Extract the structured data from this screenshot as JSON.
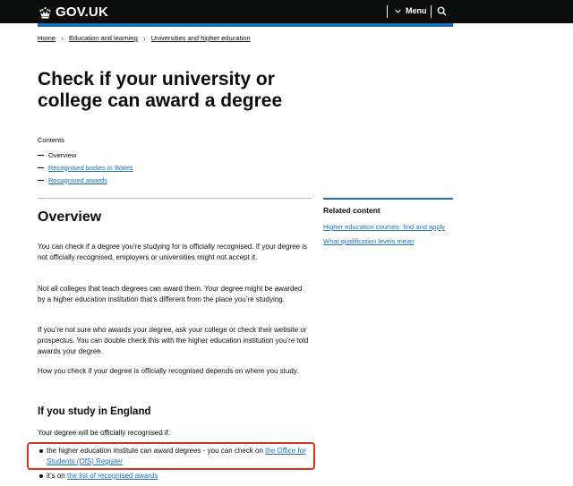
{
  "header": {
    "logo_text": "GOV.UK",
    "menu_label": "Menu"
  },
  "breadcrumb": [
    "Home",
    "Education and learning",
    "Universities and higher education"
  ],
  "page_title": "Check if your university or college can award a degree",
  "contents": {
    "label": "Contents",
    "items": [
      "Overview",
      "Recognised bodies in Wales",
      "Recognised awards"
    ]
  },
  "related": {
    "title": "Related content",
    "items": [
      "Higher education courses: find and apply",
      "What qualification levels mean"
    ]
  },
  "overview": {
    "heading": "Overview",
    "paragraphs": [
      "You can check if a degree you’re studying for is officially recognised. If your degree is not officially recognised, employers or universities might not accept it.",
      "Not all colleges that teach degrees can award them. Your degree might be awarded by a higher education institution that’s different from the place you’re studying.",
      "If you’re not sure who awards your degree, ask your college or check their website or prospectus. You can double check this with the higher education institution you’re told awards your degree.",
      "How you check if your degree is officially recognised depends on where you study."
    ]
  },
  "england": {
    "heading": "If you study in England",
    "intro": "Your degree will be officially recognised if:",
    "items": [
      {
        "text": "the higher education institute can award degrees - you can check on ",
        "link": "the Office for Students (OfS) Register"
      },
      {
        "text": "it’s on ",
        "link": "the list of recognised awards"
      }
    ]
  },
  "colors": {
    "header_bg": "#0b0c0c",
    "accent_blue": "#1d70b8",
    "link": "#1d70b8",
    "highlight": "#d4351c"
  }
}
